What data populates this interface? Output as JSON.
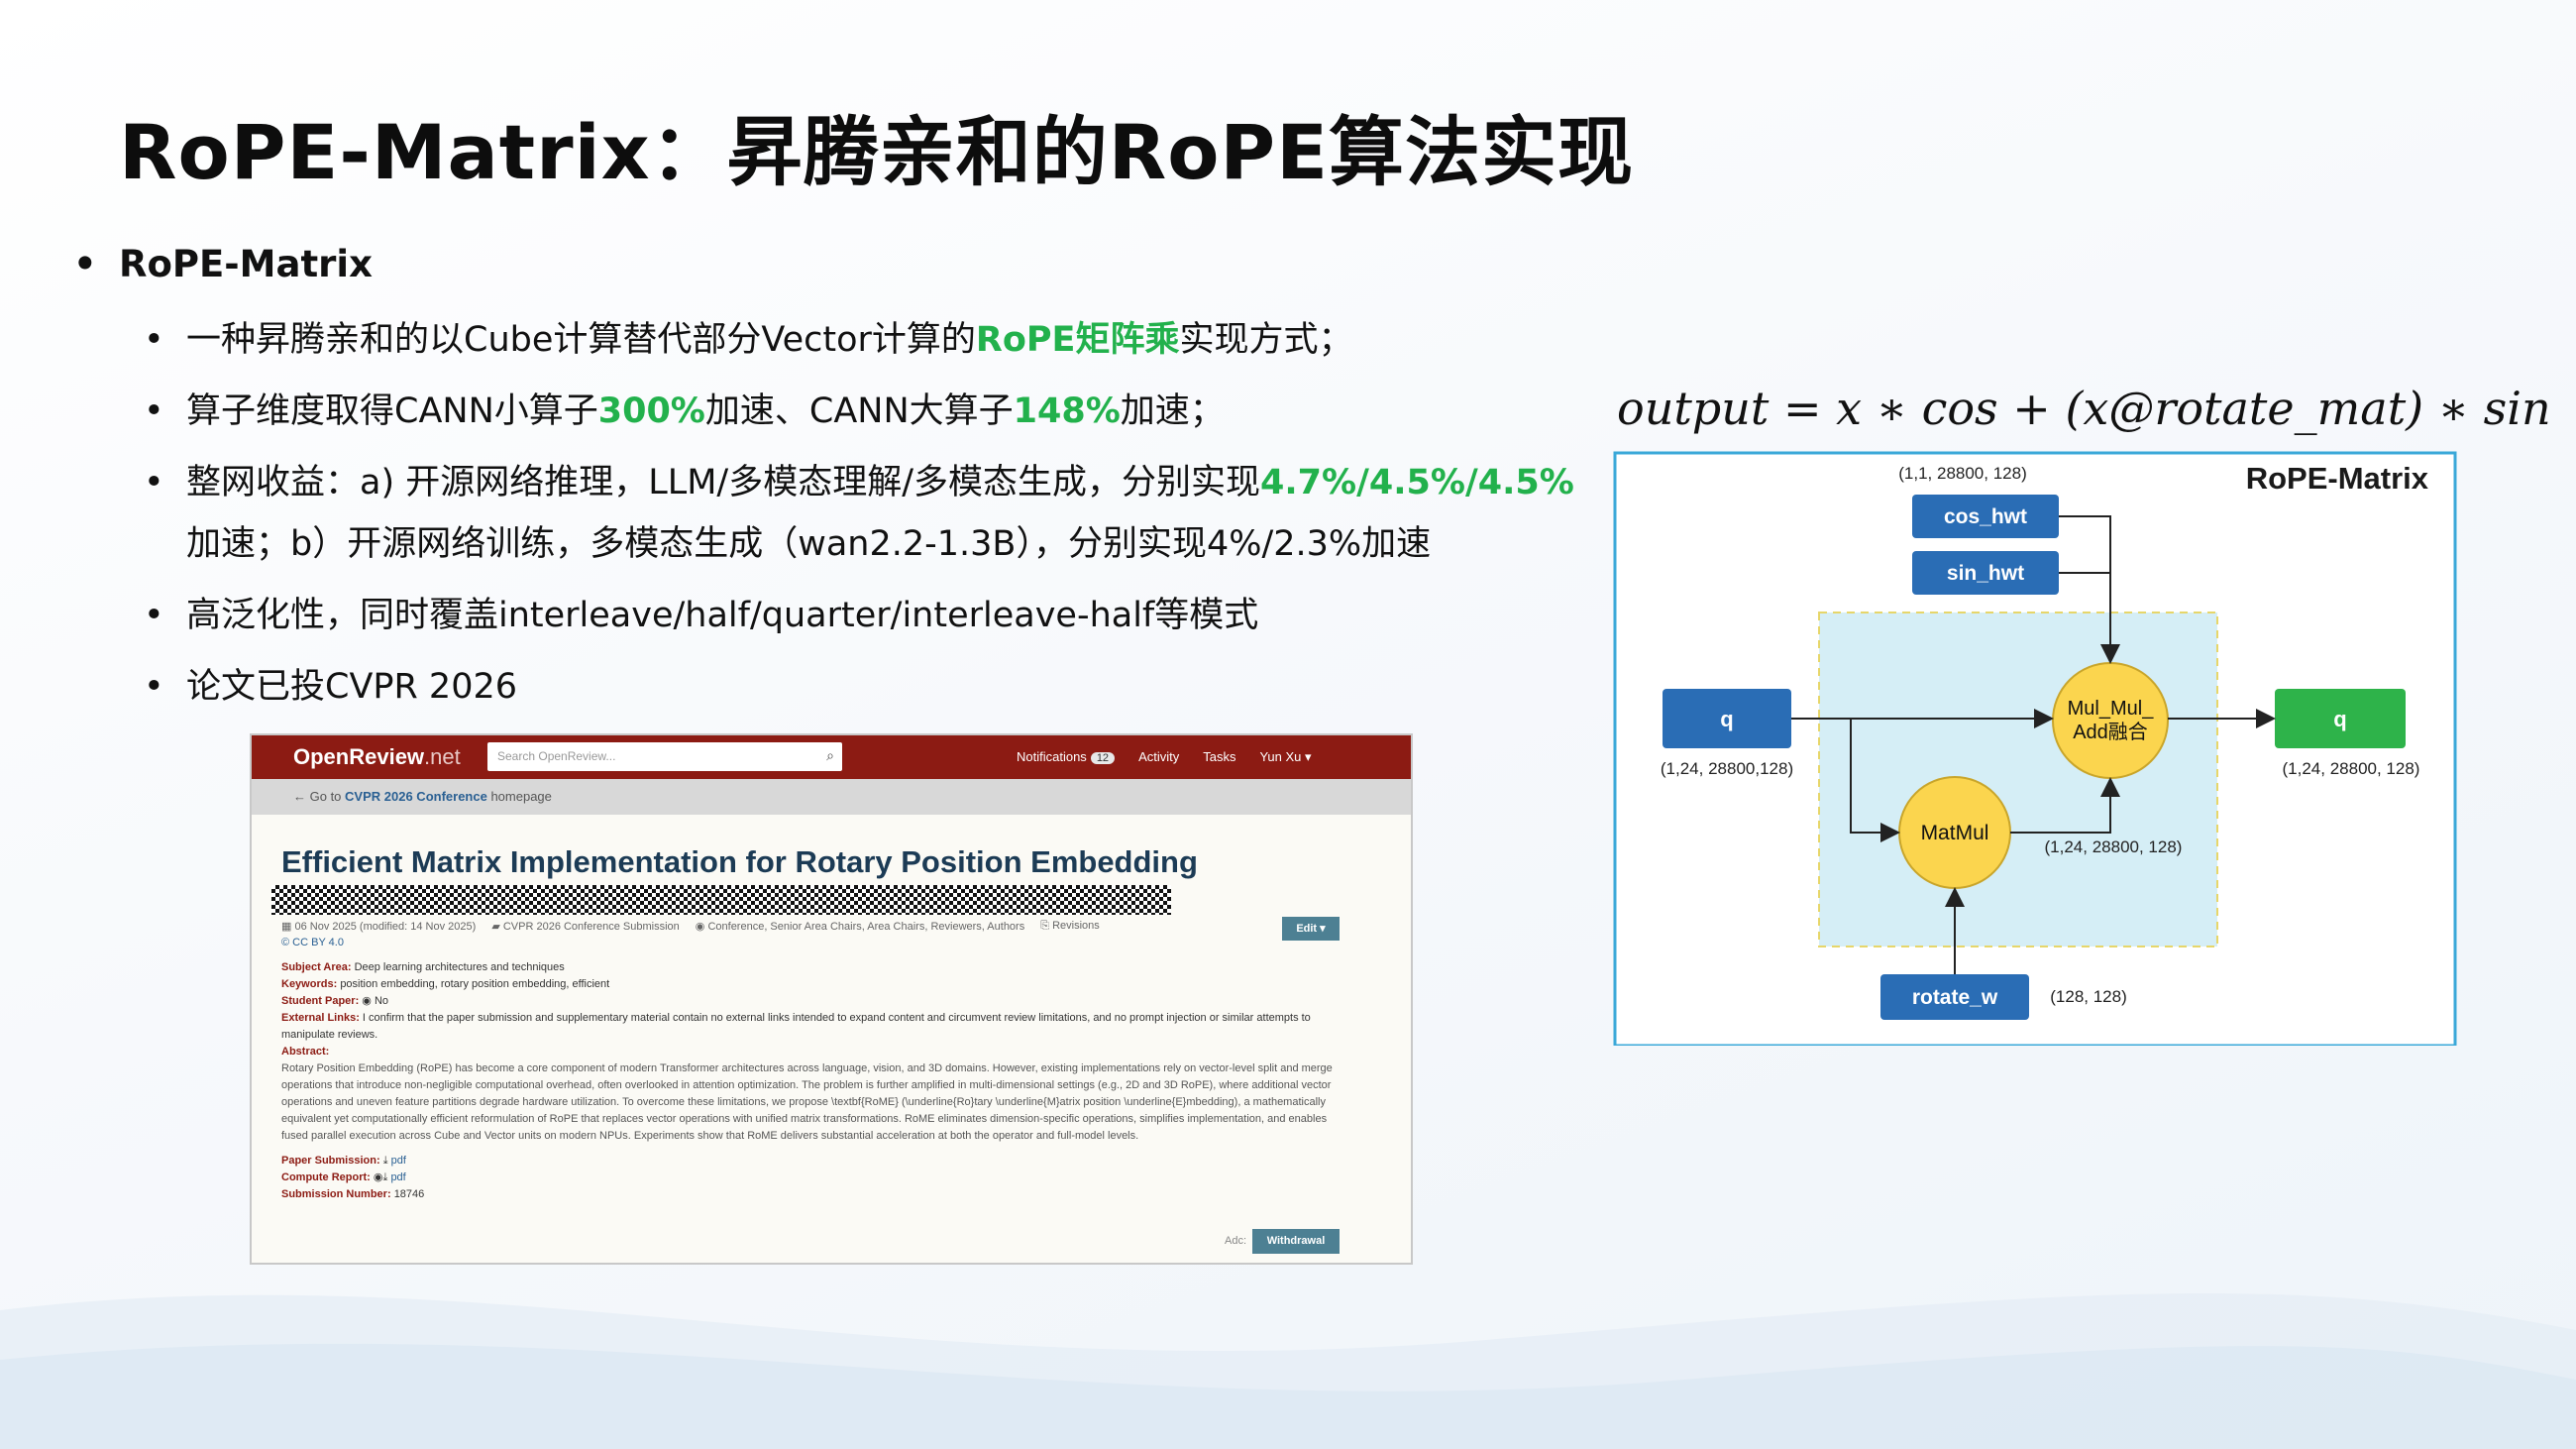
{
  "slide": {
    "title": "RoPE-Matrix：昇腾亲和的RoPE算法实现"
  },
  "bullets": {
    "level1": "RoPE-Matrix",
    "items": [
      {
        "pre": "一种昇腾亲和的以Cube计算替代部分Vector计算的",
        "hl": "RoPE矩阵乘",
        "post": "实现方式；"
      },
      {
        "pre": "算子维度取得CANN小算子",
        "hl": "300%",
        "mid": "加速、CANN大算子",
        "hl2": "148%",
        "post": "加速；"
      },
      {
        "pre": "整网收益：a) 开源网络推理，LLM/多模态理解/多模态生成，分别实现",
        "hl": "4.7%/4.5%/4.5%",
        "post": "加速；b）开源网络训练，多模态生成（wan2.2-1.3B），分别实现4%/2.3%加速"
      },
      {
        "text": "高泛化性，同时覆盖interleave/half/quarter/interleave-half等模式"
      },
      {
        "text": "论文已投CVPR 2026"
      }
    ]
  },
  "screenshot": {
    "logo_main": "OpenReview",
    "logo_suffix": ".net",
    "search_placeholder": "Search OpenReview...",
    "nav": {
      "notifications": "Notifications",
      "notifications_count": "12",
      "activity": "Activity",
      "tasks": "Tasks",
      "user": "Yun Xu ▾"
    },
    "back_link_pre": "← Go to",
    "back_link_bold": "CVPR 2026 Conference",
    "back_link_post": "homepage",
    "paper_title": "Efficient Matrix Implementation for Rotary Position Embedding",
    "meta": {
      "date": "06 Nov 2025 (modified: 14 Nov 2025)",
      "venue": "CVPR 2026 Conference Submission",
      "readers": "Conference, Senior Area Chairs, Area Chairs, Reviewers, Authors",
      "revisions": "Revisions",
      "license": "CC BY 4.0"
    },
    "edit_label": "Edit ▾",
    "fields": [
      {
        "k": "Subject Area:",
        "v": "Deep learning architectures and techniques"
      },
      {
        "k": "Keywords:",
        "v": "position embedding, rotary position embedding, efficient"
      },
      {
        "k": "Student Paper:",
        "v": "No"
      },
      {
        "k": "External Links:",
        "v": "I confirm that the paper submission and supplementary material contain no external links intended to expand content and circumvent review limitations, and no prompt injection or similar attempts to manipulate reviews."
      }
    ],
    "abstract_label": "Abstract:",
    "abstract": "Rotary Position Embedding (RoPE) has become a core component of modern Transformer architectures across language, vision, and 3D domains. However, existing implementations rely on vector-level split and merge operations that introduce non-negligible computational overhead, often overlooked in attention optimization. The problem is further amplified in multi-dimensional settings (e.g., 2D and 3D RoPE), where additional vector operations and uneven feature partitions degrade hardware utilization. To overcome these limitations, we propose \\textbf{RoME} (\\underline{Ro}tary \\underline{M}atrix position \\underline{E}mbedding), a mathematically equivalent yet computationally efficient reformulation of RoPE that replaces vector operations with unified matrix transformations. RoME eliminates dimension-specific operations, simplifies implementation, and enables fused parallel execution across Cube and Vector units on modern NPUs. Experiments show that RoME delivers substantial acceleration at both the operator and full-model levels.",
    "tail_fields": [
      {
        "k": "Paper Submission:",
        "v": "pdf"
      },
      {
        "k": "Compute Report:",
        "v": "pdf"
      },
      {
        "k": "Submission Number:",
        "v": "18746"
      }
    ],
    "adc_label": "Adc:",
    "withdraw_label": "Withdrawal"
  },
  "formula": "output = x ∗ cos + (x@rotate_mat) ∗ sin",
  "diagram": {
    "title": "RoPE-Matrix",
    "cos_label": "cos_hwt",
    "sin_label": "sin_hwt",
    "cos_shape": "(1,1, 28800, 128)",
    "q_in_label": "q",
    "q_in_shape": "(1,24, 28800,128)",
    "q_out_label": "q",
    "q_out_shape": "(1,24, 28800, 128)",
    "fuse_label_1": "Mul_Mul_",
    "fuse_label_2": "Add融合",
    "matmul_label": "MatMul",
    "matmul_shape": "(1,24, 28800, 128)",
    "rotate_label": "rotate_w",
    "rotate_shape": "(128, 128)",
    "colors": {
      "frame": "#3aa8d8",
      "blue_box": "#2a6db5",
      "green_box": "#2eb34a",
      "yellow_node": "#fbd54e",
      "region": "#d5eef6"
    }
  }
}
